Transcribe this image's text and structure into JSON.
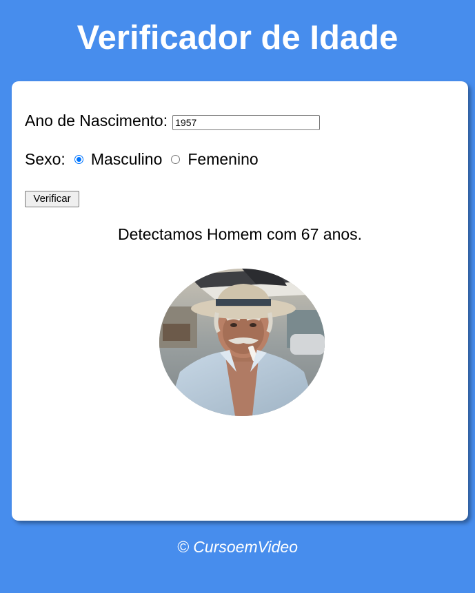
{
  "header": {
    "title": "Verificador de Idade"
  },
  "form": {
    "year_label": "Ano de Nascimento:",
    "year_value": "1957",
    "sex_label": "Sexo:",
    "options": [
      {
        "label": "Masculino",
        "checked": true
      },
      {
        "label": "Femenino",
        "checked": false
      }
    ],
    "verify_label": "Verificar"
  },
  "result": {
    "text": "Detectamos Homem com 67 anos.",
    "photo_icon": "elderly-man-photo"
  },
  "footer": {
    "text": "© CursoemVideo"
  },
  "colors": {
    "background": "#478ded",
    "card": "#ffffff",
    "radio_accent": "#0075ff"
  }
}
